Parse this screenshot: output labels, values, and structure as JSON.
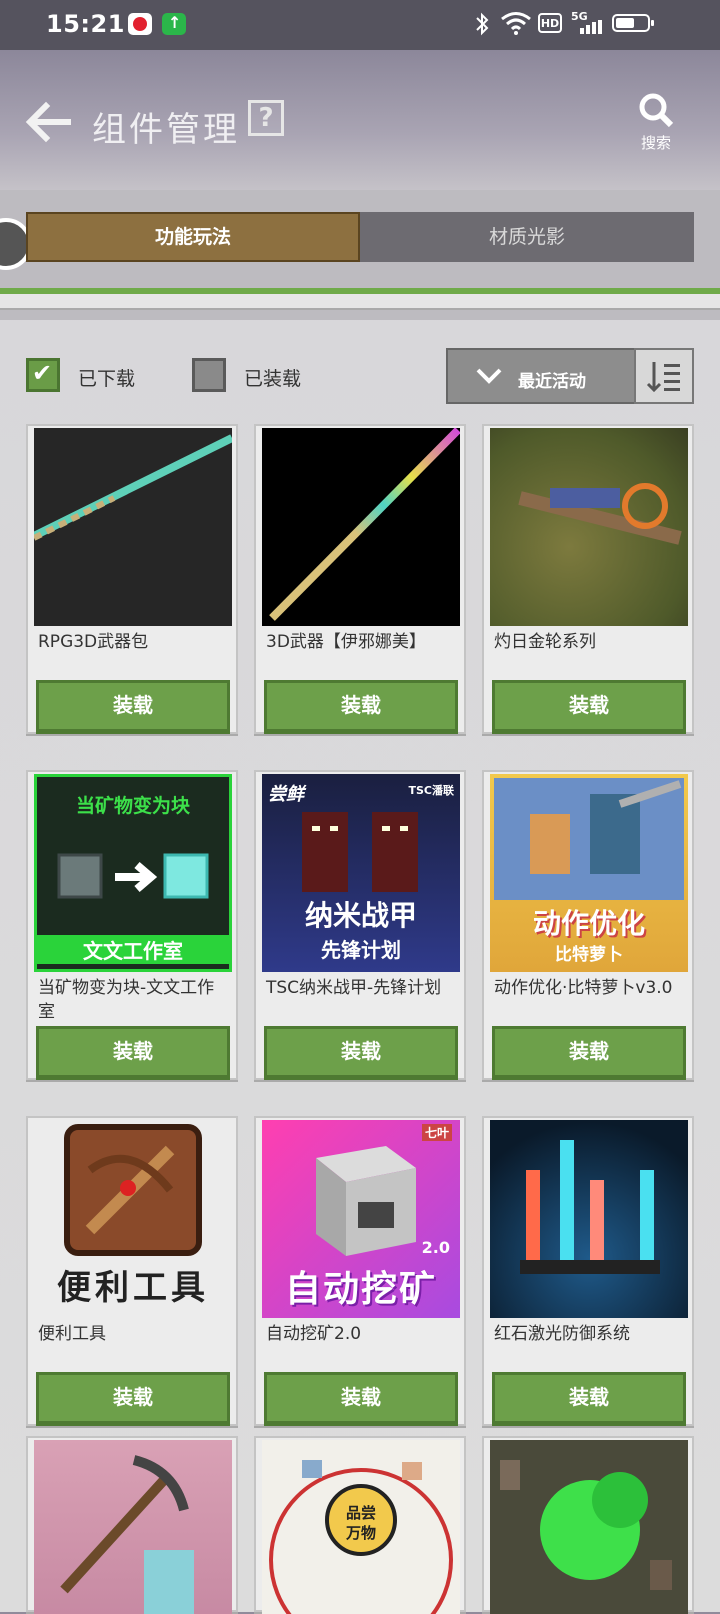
{
  "status_bar": {
    "time": "15:21",
    "network": "5G",
    "hd": "HD"
  },
  "header": {
    "title": "组件管理",
    "help_label": "?",
    "search_label": "搜索"
  },
  "tabs": [
    {
      "label": "功能玩法",
      "active": true
    },
    {
      "label": "材质光影",
      "active": false
    }
  ],
  "filters": {
    "downloaded": {
      "label": "已下载",
      "checked": true
    },
    "installed": {
      "label": "已装载",
      "checked": false
    },
    "sort": {
      "label": "最近活动"
    }
  },
  "colors": {
    "accent_green": "#6da04a",
    "tab_active": "#8d7040"
  },
  "items": [
    {
      "name": "RPG3D武器包",
      "button": "装载",
      "thumb": "sword-dark"
    },
    {
      "name": "3D武器【伊邪娜美】",
      "button": "装载",
      "thumb": "sword-rainbow"
    },
    {
      "name": "灼日金轮系列",
      "button": "装载",
      "thumb": "sword-grass"
    },
    {
      "name": "当矿物变为块-文文工作室",
      "button": "装载",
      "thumb": "ore-to-block",
      "thumb_text": [
        "当矿物变为块",
        "文文工作室"
      ]
    },
    {
      "name": "TSC纳米战甲-先锋计划",
      "button": "装载",
      "thumb": "nano-armor",
      "thumb_text": [
        "尝鲜",
        "TSC潘联",
        "纳米战甲",
        "先锋计划"
      ]
    },
    {
      "name": "动作优化·比特萝卜v3.0",
      "button": "装载",
      "thumb": "action",
      "thumb_text": [
        "动作优化",
        "比特萝卜"
      ]
    },
    {
      "name": "便利工具",
      "button": "装载",
      "thumb": "tools",
      "thumb_text": [
        "便利工具"
      ]
    },
    {
      "name": "自动挖矿2.0",
      "button": "装载",
      "thumb": "auto-mine",
      "thumb_text": [
        "七叶",
        "2.0",
        "自动挖矿"
      ]
    },
    {
      "name": "红石激光防御系统",
      "button": "装载",
      "thumb": "laser"
    },
    {
      "name": "",
      "button": "",
      "thumb": "pickaxe"
    },
    {
      "name": "",
      "button": "",
      "thumb": "taste",
      "thumb_text": [
        "品尝",
        "万物"
      ]
    },
    {
      "name": "",
      "button": "",
      "thumb": "green-blob"
    }
  ]
}
